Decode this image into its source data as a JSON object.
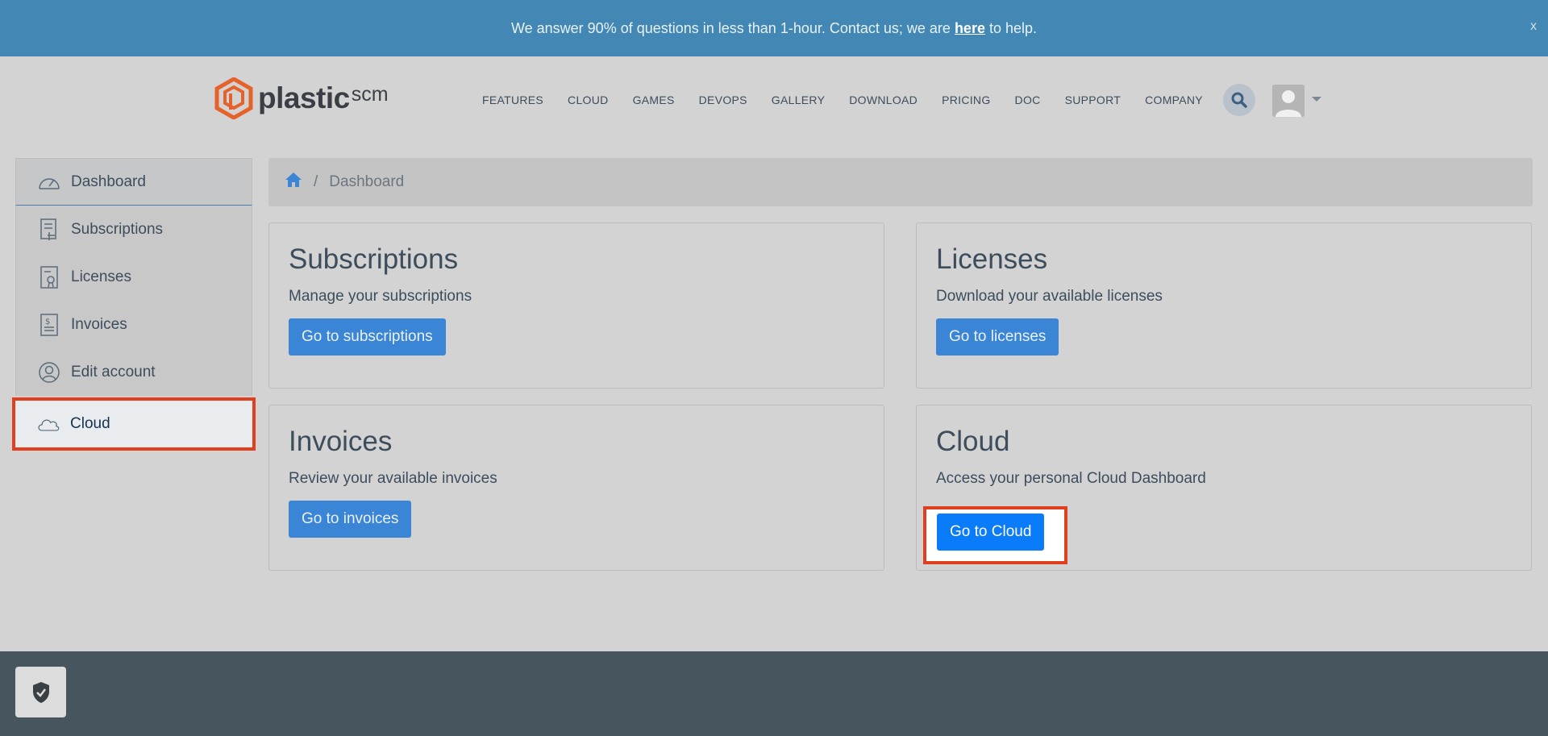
{
  "banner": {
    "text_before": "We answer 90% of questions in less than 1-hour. Contact us; we are",
    "link": "here",
    "text_after": "to help.",
    "close": "x"
  },
  "header": {
    "logo_text": "plastic",
    "logo_suffix": "scm",
    "nav": [
      "FEATURES",
      "CLOUD",
      "GAMES",
      "DEVOPS",
      "GALLERY",
      "DOWNLOAD",
      "PRICING",
      "DOC",
      "SUPPORT",
      "COMPANY"
    ]
  },
  "sidebar": {
    "items": [
      {
        "label": "Dashboard",
        "icon": "speedometer-icon"
      },
      {
        "label": "Subscriptions",
        "icon": "subscription-icon"
      },
      {
        "label": "Licenses",
        "icon": "license-icon"
      },
      {
        "label": "Invoices",
        "icon": "invoice-icon"
      },
      {
        "label": "Edit account",
        "icon": "user-circle-icon"
      },
      {
        "label": "Cloud",
        "icon": "cloud-icon"
      }
    ]
  },
  "breadcrumb": {
    "current": "Dashboard"
  },
  "cards": [
    {
      "title": "Subscriptions",
      "desc": "Manage your subscriptions",
      "button": "Go to subscriptions"
    },
    {
      "title": "Licenses",
      "desc": "Download your available licenses",
      "button": "Go to licenses"
    },
    {
      "title": "Invoices",
      "desc": "Review your available invoices",
      "button": "Go to invoices"
    },
    {
      "title": "Cloud",
      "desc": "Access your personal Cloud Dashboard",
      "button": "Go to Cloud"
    }
  ],
  "colors": {
    "banner": "#4388b4",
    "accent": "#3b85d6",
    "highlight": "#e0401f",
    "footer": "#47555f"
  }
}
